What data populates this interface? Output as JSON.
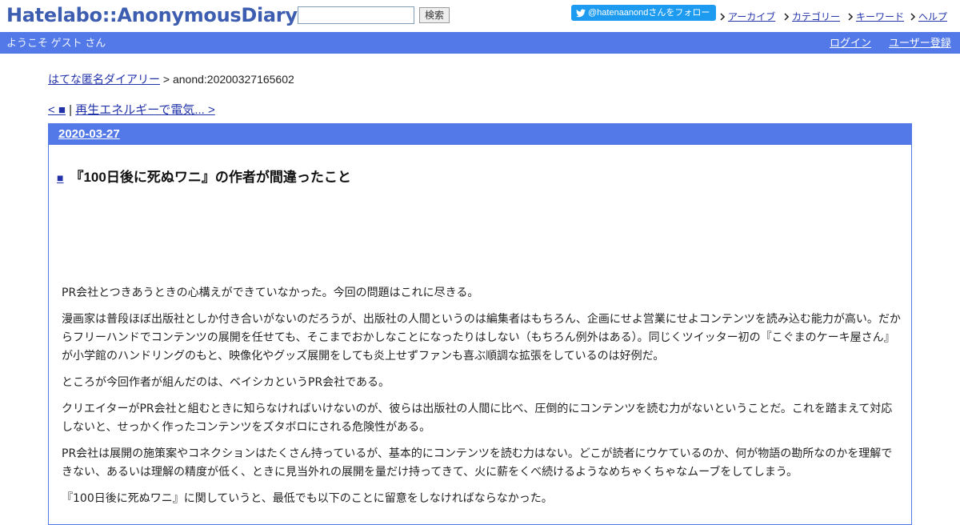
{
  "header": {
    "logo": "Hatelabo::AnonymousDiary",
    "search_placeholder": "",
    "search_button": "検索",
    "twitter_label": "@hatenaanondさんをフォロー",
    "nav": [
      "アーカイブ",
      "カテゴリー",
      "キーワード",
      "ヘルプ"
    ]
  },
  "bar": {
    "welcome": "ようこそ ゲスト さん",
    "login": "ログイン",
    "register": "ユーザー登録"
  },
  "breadcrumb": {
    "home": "はてな匿名ダイアリー",
    "separator": " > ",
    "current": "anond:20200327165602"
  },
  "pager": {
    "prev": "< ■",
    "separator": " | ",
    "next": "再生エネルギーで電気... >"
  },
  "entry": {
    "date": "2020-03-27",
    "title_mark": "■",
    "title": "『100日後に死ぬワニ』の作者が間違ったこと",
    "paragraphs": [
      "PR会社とつきあうときの心構えができていなかった。今回の問題はこれに尽きる。",
      "漫画家は普段ほぼ出版社としか付き合いがないのだろうが、出版社の人間というのは編集者はもちろん、企画にせよ営業にせよコンテンツを読み込む能力が高い。だからフリーハンドでコンテンツの展開を任せても、そこまでおかしなことになったりはしない（もちろん例外はある）。同じくツイッター初の『こぐまのケーキ屋さん』が小学館のハンドリングのもと、映像化やグッズ展開をしても炎上せずファンも喜ぶ順調な拡張をしているのは好例だ。",
      "ところが今回作者が組んだのは、ベイシカというPR会社である。",
      "クリエイターがPR会社と組むときに知らなければいけないのが、彼らは出版社の人間に比べ、圧倒的にコンテンツを読む力がないということだ。これを踏まえて対応しないと、せっかく作ったコンテンツをズタボロにされる危険性がある。",
      "PR会社は展開の施策案やコネクションはたくさん持っているが、基本的にコンテンツを読む力はない。どこが読者にウケているのか、何が物語の勘所なのかを理解できない、あるいは理解の精度が低く、ときに見当外れの展開を量だけ持ってきて、火に薪をくべ続けるようなめちゃくちゃなムーブをしてしまう。",
      "『100日後に死ぬワニ』に関していうと、最低でも以下のことに留意をしなければならなかった。"
    ]
  }
}
